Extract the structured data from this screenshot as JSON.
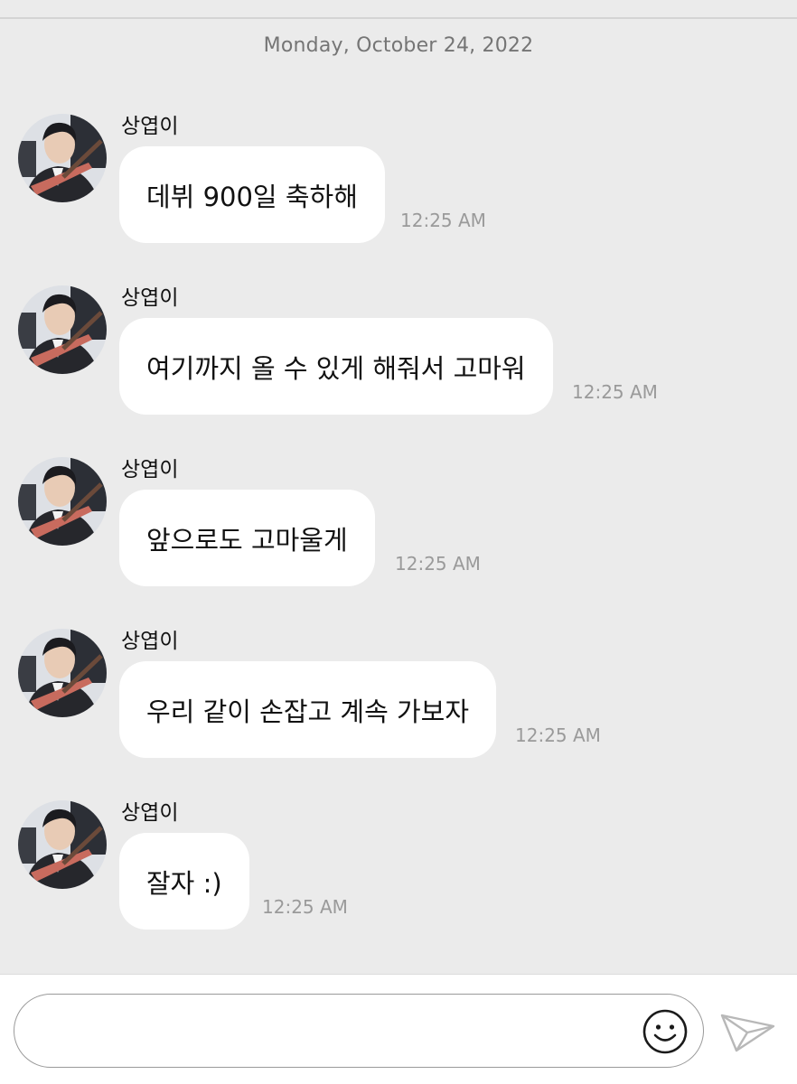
{
  "chat": {
    "date_label": "Monday, October 24, 2022",
    "messages": [
      {
        "sender": "상엽이",
        "text": "데뷔 900일 축하해",
        "time": "12:25 AM"
      },
      {
        "sender": "상엽이",
        "text": "여기까지 올 수 있게 해줘서 고마워",
        "time": "12:25 AM"
      },
      {
        "sender": "상엽이",
        "text": "앞으로도 고마울게",
        "time": "12:25 AM"
      },
      {
        "sender": "상엽이",
        "text": "우리 같이 손잡고 계속 가보자",
        "time": "12:25 AM"
      },
      {
        "sender": "상엽이",
        "text": "잘자 :)",
        "time": "12:25 AM"
      }
    ]
  },
  "composer": {
    "placeholder": "",
    "emoji_icon": "smiley-icon",
    "send_icon": "paper-plane-icon"
  },
  "colors": {
    "chat_background": "#ebebeb",
    "bubble": "#ffffff",
    "timestamp": "#9a9a9a"
  }
}
